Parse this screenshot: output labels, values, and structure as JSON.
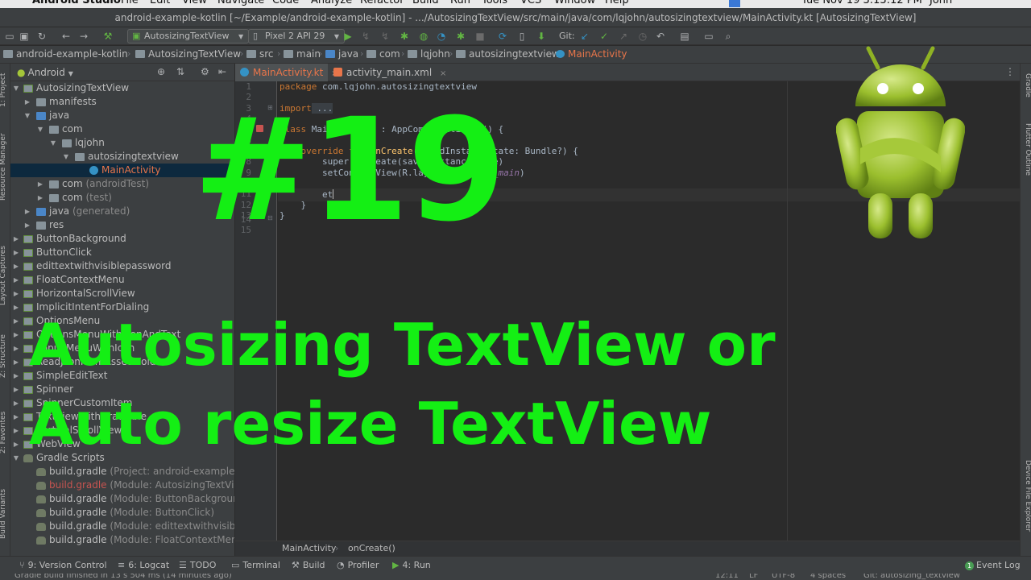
{
  "menubar": {
    "items": [
      "Android Studio",
      "File",
      "Edit",
      "View",
      "Navigate",
      "Code",
      "Analyze",
      "Refactor",
      "Build",
      "Run",
      "Tools",
      "VCS",
      "Window",
      "Help"
    ],
    "clock": "Tue Nov 19  3:13:12 PM",
    "user": "John"
  },
  "window": {
    "title": "android-example-kotlin [~/Example/android-example-kotlin] - .../AutosizingTextView/src/main/java/com/lqjohn/autosizingtextview/MainActivity.kt [AutosizingTextView]"
  },
  "toolbar": {
    "run_config": "AutosizingTextView",
    "device": "Pixel 2 API 29",
    "git_label": "Git:"
  },
  "breadcrumb": [
    "android-example-kotlin",
    "AutosizingTextView",
    "src",
    "main",
    "java",
    "com",
    "lqjohn",
    "autosizingtextview",
    "MainActivity"
  ],
  "left_strip": [
    "1: Project",
    "Resource Manager",
    "Layout Captures",
    "Z: Structure",
    "2: Favorites",
    "Build Variants"
  ],
  "project_panel": {
    "view_mode": "Android",
    "rows": [
      {
        "label": "AutosizingTextView",
        "suffix": ""
      },
      {
        "label": "manifests",
        "suffix": ""
      },
      {
        "label": "java",
        "suffix": ""
      },
      {
        "label": "com",
        "suffix": ""
      },
      {
        "label": "lqjohn",
        "suffix": ""
      },
      {
        "label": "autosizingtextview",
        "suffix": ""
      },
      {
        "label": "MainActivity",
        "suffix": ""
      },
      {
        "label": "com",
        "suffix": "(androidTest)"
      },
      {
        "label": "com",
        "suffix": "(test)"
      },
      {
        "label": "java",
        "suffix": "(generated)"
      },
      {
        "label": "res",
        "suffix": ""
      },
      {
        "label": "ButtonBackground",
        "suffix": ""
      },
      {
        "label": "ButtonClick",
        "suffix": ""
      },
      {
        "label": "edittextwithvisiblepassword",
        "suffix": ""
      },
      {
        "label": "FloatContextMenu",
        "suffix": ""
      },
      {
        "label": "HorizontalScrollView",
        "suffix": ""
      },
      {
        "label": "ImplicitIntentForDialing",
        "suffix": ""
      },
      {
        "label": "OptionsMenu",
        "suffix": ""
      },
      {
        "label": "OptionsMenuWithIconAndText",
        "suffix": ""
      },
      {
        "label": "PopupMenuWithIcon",
        "suffix": ""
      },
      {
        "label": "ReadJsonFromAssetsFolder",
        "suffix": ""
      },
      {
        "label": "SimpleEditText",
        "suffix": ""
      },
      {
        "label": "Spinner",
        "suffix": ""
      },
      {
        "label": "SpinnerCustomItem",
        "suffix": ""
      },
      {
        "label": "TextViewWithDrawable",
        "suffix": ""
      },
      {
        "label": "VerticalScrollView",
        "suffix": ""
      },
      {
        "label": "WebView",
        "suffix": ""
      },
      {
        "label": "Gradle Scripts",
        "suffix": ""
      },
      {
        "label": "build.gradle",
        "suffix": "(Project: android-example-kotlin)"
      },
      {
        "label": "build.gradle",
        "suffix": "(Module: AutosizingTextView)"
      },
      {
        "label": "build.gradle",
        "suffix": "(Module: ButtonBackground)"
      },
      {
        "label": "build.gradle",
        "suffix": "(Module: ButtonClick)"
      },
      {
        "label": "build.gradle",
        "suffix": "(Module: edittextwithvisiblepassword)"
      },
      {
        "label": "build.gradle",
        "suffix": "(Module: FloatContextMenu)"
      }
    ]
  },
  "editor": {
    "tabs": [
      {
        "label": "MainActivity.kt",
        "close": "×"
      },
      {
        "label": "activity_main.xml",
        "close": "×"
      }
    ],
    "line_numbers": [
      "1",
      "2",
      "3",
      "4",
      "5",
      "6",
      "7",
      "8",
      "9",
      "10",
      "11",
      "12",
      "13",
      "14",
      "15"
    ],
    "code": {
      "l1_kw": "package",
      "l1_rest": " com.lqjohn.autosizingtextview",
      "l3_kw": "import",
      "l3_rest": " ...",
      "l5_kw": "class",
      "l5_rest": " MainActivity : AppCompatActivity() {",
      "l7_kw": "    override fun",
      "l7_fn": " onCreate",
      "l7_rest": "(savedInstanceState: Bundle?) {",
      "l8": "        super.onCreate(savedInstanceState)",
      "l9a": "        setContentView(R.layout.",
      "l9b": "activity_main",
      "l9c": ")",
      "l11": "        et",
      "l12": "    }",
      "l13": "}"
    },
    "crumb": [
      "MainActivity",
      "onCreate()"
    ]
  },
  "right_strip": [
    "Gradle",
    "Flutter Outline",
    "Device File Explorer"
  ],
  "bottom_tools": [
    {
      "label": "9: Version Control",
      "icon": "⑂"
    },
    {
      "label": "6: Logcat",
      "icon": "≡"
    },
    {
      "label": "TODO",
      "icon": "☰"
    },
    {
      "label": "Terminal",
      "icon": "▭"
    },
    {
      "label": "Build",
      "icon": "⚒"
    },
    {
      "label": "Profiler",
      "icon": "◔"
    },
    {
      "label": "4: Run",
      "icon": "▶"
    }
  ],
  "event_log": {
    "label": "Event Log",
    "count": "1"
  },
  "status": {
    "message": "Gradle build finished in 13 s 504 ms (14 minutes ago)",
    "position": "12:11",
    "line_sep": "LF",
    "encoding": "UTF-8",
    "indent": "4 spaces",
    "vcs": "Git: autosizing_textview"
  },
  "overlay": {
    "number": "#19",
    "line1": "Autosizing TextView or",
    "line2": "Auto resize TextView"
  },
  "colors": {
    "overlay_green": "#14ef14",
    "android_green": "#a4c639",
    "ide_background": "#2b2b2b"
  }
}
